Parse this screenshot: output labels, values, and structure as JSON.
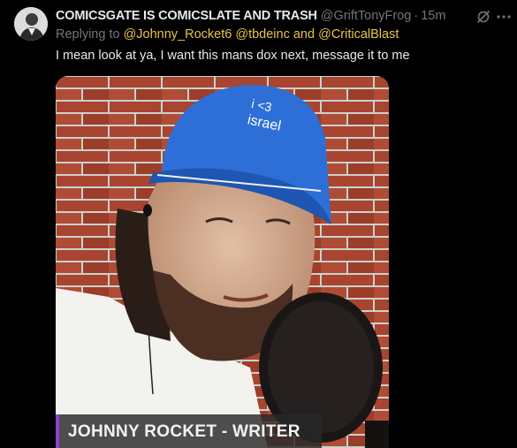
{
  "tweet": {
    "display_name": "COMICSGATE IS COMICSLATE AND TRASH",
    "handle": "@GriftTonyFrog",
    "separator": "·",
    "time": "15m",
    "replying_prefix": "Replying to ",
    "mentions": [
      "@Johnny_Rocket6",
      "@tbdeinc",
      "@CriticalBlast"
    ],
    "mention_joiner": "and",
    "text": "I mean look at ya, I want this mans dox next, message it to me",
    "media": {
      "cap_text": [
        "i <3",
        "israel"
      ],
      "caption": "JOHNNY ROCKET - WRITER"
    }
  },
  "icons": {
    "avatar": "avatar",
    "grok": "grok-icon",
    "more": "more-icon"
  },
  "colors": {
    "background": "#000000",
    "text": "#e7e9ea",
    "muted": "#71767b",
    "mention": "#e6c44a",
    "cap": "#2d6fd6",
    "caption_accent": "#8b3fd0"
  }
}
